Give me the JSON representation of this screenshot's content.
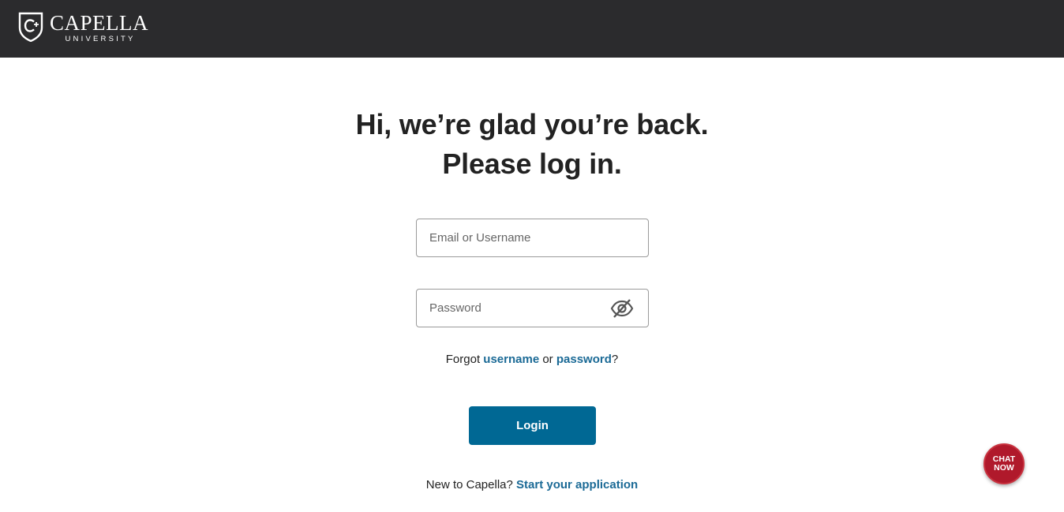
{
  "header": {
    "logo_name": "CAPELLA",
    "logo_sub": "UNIVERSITY",
    "background": "#2b2b2d"
  },
  "main": {
    "heading_line1": "Hi, we’re glad you’re back.",
    "heading_line2": "Please log in.",
    "email_placeholder": "Email or Username",
    "password_placeholder": "Password",
    "password_toggle_icon": "eye-slash-icon",
    "forgot_prefix": "Forgot ",
    "forgot_username": "username",
    "forgot_or": " or ",
    "forgot_password": "password",
    "forgot_suffix": "?",
    "login_label": "Login",
    "new_prefix": "New to Capella? ",
    "new_link": "Start your application"
  },
  "chat": {
    "line1": "CHAT",
    "line2": "NOW",
    "color": "#b0192b"
  },
  "colors": {
    "accent": "#006894",
    "link": "#1b6a96"
  }
}
